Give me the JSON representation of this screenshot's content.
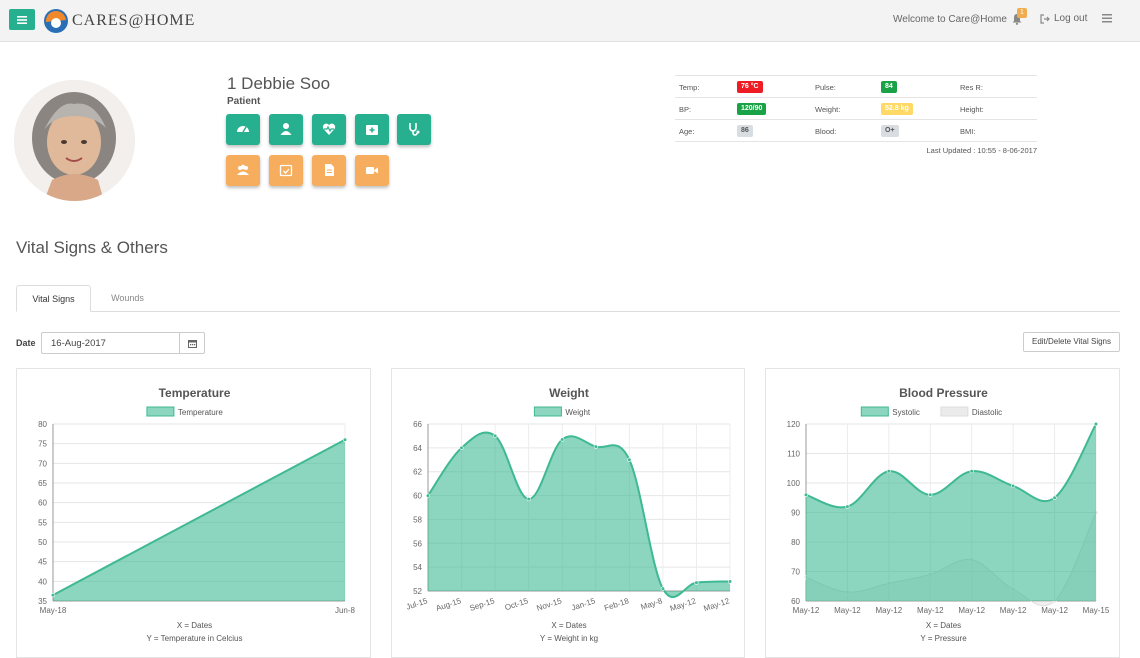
{
  "header": {
    "logo_text": "CARES@HOME",
    "welcome": "Welcome to Care@Home",
    "notification_count": "1",
    "logout_label": "Log out"
  },
  "patient": {
    "name": "1 Debbie Soo",
    "role": "Patient"
  },
  "quick_actions": [
    {
      "icon": "dashboard-icon",
      "color": "#26b08f"
    },
    {
      "icon": "user-icon",
      "color": "#26b08f"
    },
    {
      "icon": "heartbeat-icon",
      "color": "#26b08f"
    },
    {
      "icon": "medkit-icon",
      "color": "#26b08f"
    },
    {
      "icon": "stethoscope-icon",
      "color": "#26b08f"
    },
    {
      "icon": "group-icon",
      "color": "#f6ae5e"
    },
    {
      "icon": "calendar-check-icon",
      "color": "#f6ae5e"
    },
    {
      "icon": "document-icon",
      "color": "#f6ae5e"
    },
    {
      "icon": "video-icon",
      "color": "#f6ae5e"
    }
  ],
  "vitals": {
    "temp_label": "Temp:",
    "temp_value": "76 °C",
    "pulse_label": "Pulse:",
    "pulse_value": "84",
    "resr_label": "Res R:",
    "bp_label": "BP:",
    "bp_value": "120/90",
    "weight_label": "Weight:",
    "weight_value": "52.8 kg",
    "height_label": "Height:",
    "age_label": "Age:",
    "age_value": "86",
    "blood_label": "Blood:",
    "blood_value": "O+",
    "bmi_label": "BMI:",
    "last_updated": "Last Updated : 10:55 - 8-06-2017",
    "colors": {
      "danger": "#ee1c24",
      "success": "#1aa346",
      "warning": "#ffd966",
      "neutral": "#d8dde2"
    }
  },
  "section": {
    "title": "Vital Signs & Others",
    "tabs": [
      "Vital Signs",
      "Wounds"
    ]
  },
  "filter": {
    "date_label": "Date",
    "date_value": "16-Aug-2017",
    "edit_label": "Edit/Delete Vital Signs"
  },
  "chart_data": [
    {
      "type": "area",
      "title": "Temperature",
      "x": [
        "May-18",
        "Jun-8"
      ],
      "series": [
        {
          "name": "Temperature",
          "values": [
            36.5,
            76
          ],
          "color": "#3fb993"
        }
      ],
      "ylim": [
        35,
        80
      ],
      "yticks": [
        35,
        40,
        45,
        50,
        55,
        60,
        65,
        70,
        75,
        80
      ],
      "xlabel": "X = Dates",
      "ylabel": "Y = Temperature in Celcius",
      "grid": true,
      "legend": "top"
    },
    {
      "type": "area",
      "title": "Weight",
      "x": [
        "Jul-15",
        "Aug-15",
        "Sep-15",
        "Oct-15",
        "Nov-15",
        "Jan-15",
        "Feb-18",
        "May-8",
        "May-12",
        "May-12"
      ],
      "series": [
        {
          "name": "Weight",
          "values": [
            60,
            64,
            65,
            59.7,
            64.7,
            64.1,
            63,
            52.2,
            52.7,
            52.8
          ],
          "color": "#3fb993"
        }
      ],
      "ylim": [
        52,
        66
      ],
      "yticks": [
        52,
        54,
        56,
        58,
        60,
        62,
        64,
        66
      ],
      "xlabel": "X = Dates",
      "ylabel": "Y = Weight in kg",
      "grid": true,
      "legend": "top"
    },
    {
      "type": "area",
      "title": "Blood Pressure",
      "x": [
        "May-12",
        "May-12",
        "May-12",
        "May-12",
        "May-12",
        "May-12",
        "May-12",
        "May-15"
      ],
      "series": [
        {
          "name": "Systolic",
          "values": [
            96,
            92,
            104,
            96,
            104,
            99,
            95,
            120
          ],
          "color": "#3fb993"
        },
        {
          "name": "Diastolic",
          "values": [
            68,
            63,
            66,
            69,
            74,
            64,
            60,
            90
          ],
          "color": "#dddddd"
        }
      ],
      "ylim": [
        60,
        120
      ],
      "yticks": [
        60,
        70,
        80,
        90,
        100,
        110,
        120
      ],
      "xlabel": "X = Dates",
      "ylabel": "Y = Pressure",
      "grid": true,
      "legend": "top"
    }
  ]
}
